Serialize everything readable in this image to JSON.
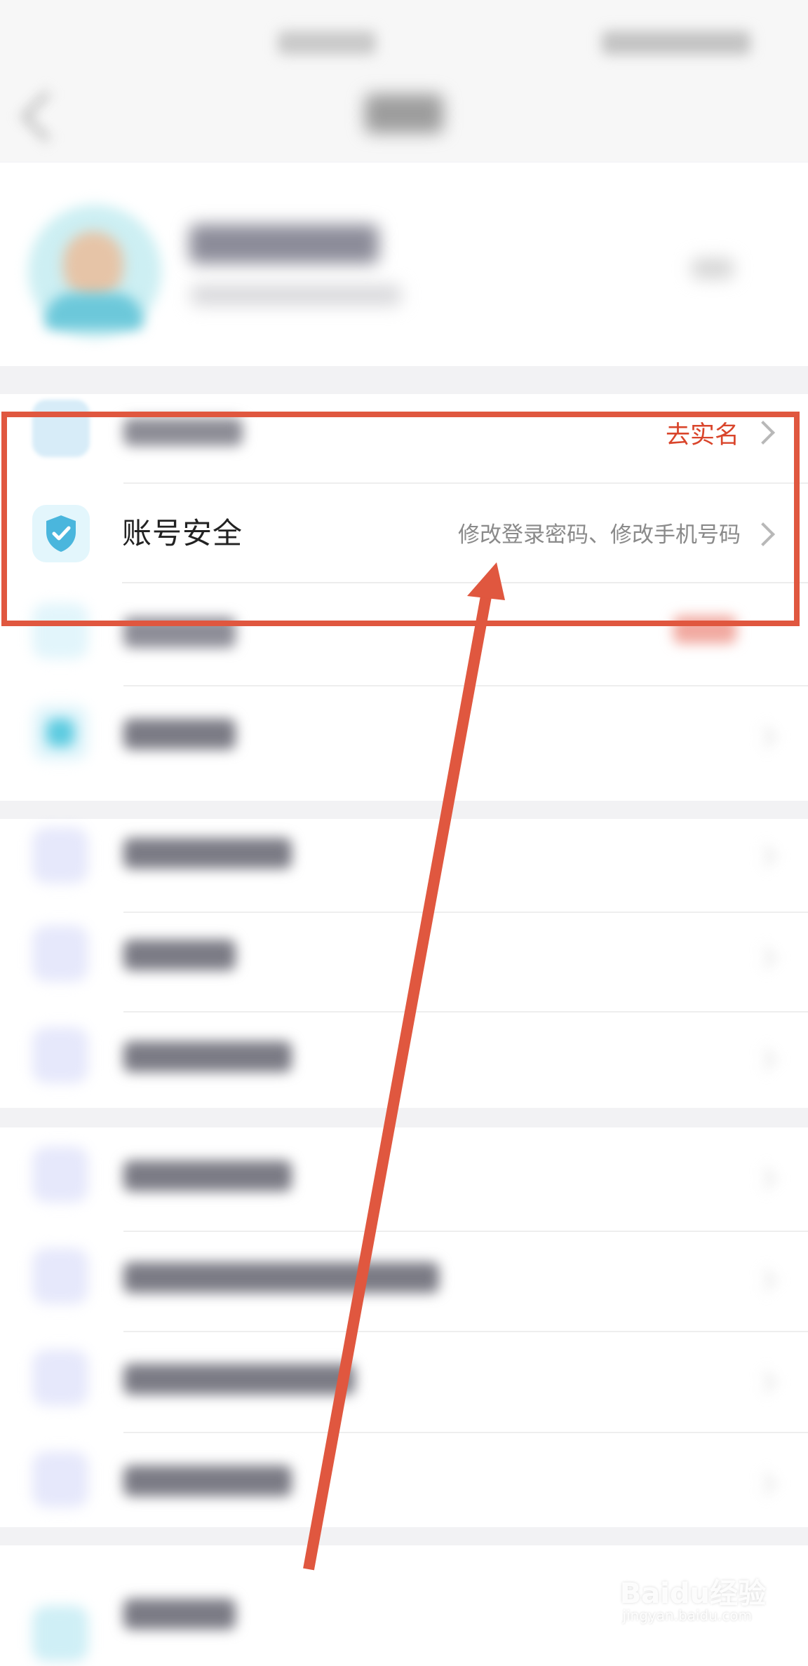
{
  "rows": {
    "realname": {
      "action_label": "去实名"
    },
    "account_security": {
      "label": "账号安全",
      "subtitle": "修改登录密码、修改手机号码"
    }
  },
  "watermark": {
    "brand": "Baidu经验",
    "url": "jingyan.baidu.com"
  },
  "colors": {
    "annotation": "#e0573f",
    "link_red": "#d9452b",
    "shield_blue": "#4ab6dd"
  }
}
